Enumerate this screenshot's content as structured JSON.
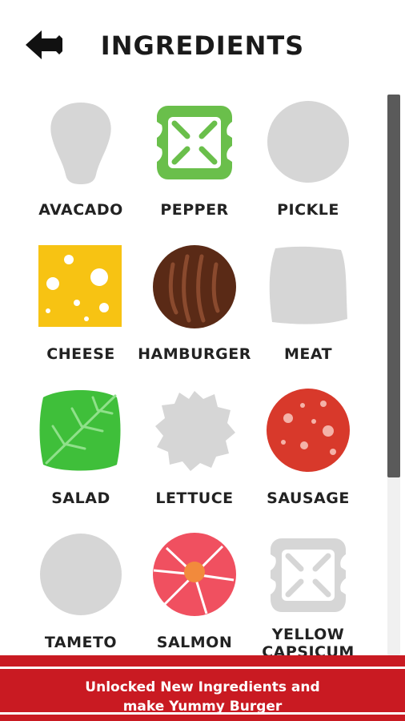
{
  "header": {
    "title": "INGREDIENTS",
    "back_icon": "arrow-left-icon"
  },
  "ingredients": [
    {
      "label": "AVACADO",
      "icon": "avocado-icon",
      "locked": true
    },
    {
      "label": "PEPPER",
      "icon": "pepper-icon",
      "locked": false
    },
    {
      "label": "PICKLE",
      "icon": "pickle-icon",
      "locked": true
    },
    {
      "label": "CHEESE",
      "icon": "cheese-icon",
      "locked": false
    },
    {
      "label": "HAMBURGER",
      "icon": "hamburger-patty-icon",
      "locked": false
    },
    {
      "label": "MEAT",
      "icon": "meat-icon",
      "locked": true
    },
    {
      "label": "SALAD",
      "icon": "salad-leaf-icon",
      "locked": false
    },
    {
      "label": "LETTUCE",
      "icon": "lettuce-icon",
      "locked": true
    },
    {
      "label": "SAUSAGE",
      "icon": "sausage-slice-icon",
      "locked": false
    },
    {
      "label": "TAMETO",
      "icon": "tomato-icon",
      "locked": true
    },
    {
      "label": "SALMON",
      "icon": "salmon-icon",
      "locked": false
    },
    {
      "label": "YELLOW CAPSICUM",
      "icon": "yellow-capsicum-icon",
      "locked": true
    }
  ],
  "banner": {
    "line1": "Unlocked New Ingredients and",
    "line2": "make Yummy Burger"
  },
  "colors": {
    "locked_gray": "#d6d6d6",
    "pepper_green": "#6abf4b",
    "cheese_yellow": "#f7c313",
    "patty_brown": "#5a2a16",
    "salad_green": "#3fbf3a",
    "sausage_red": "#d8392b",
    "salmon_red": "#f05060",
    "banner_red": "#c91a22"
  }
}
